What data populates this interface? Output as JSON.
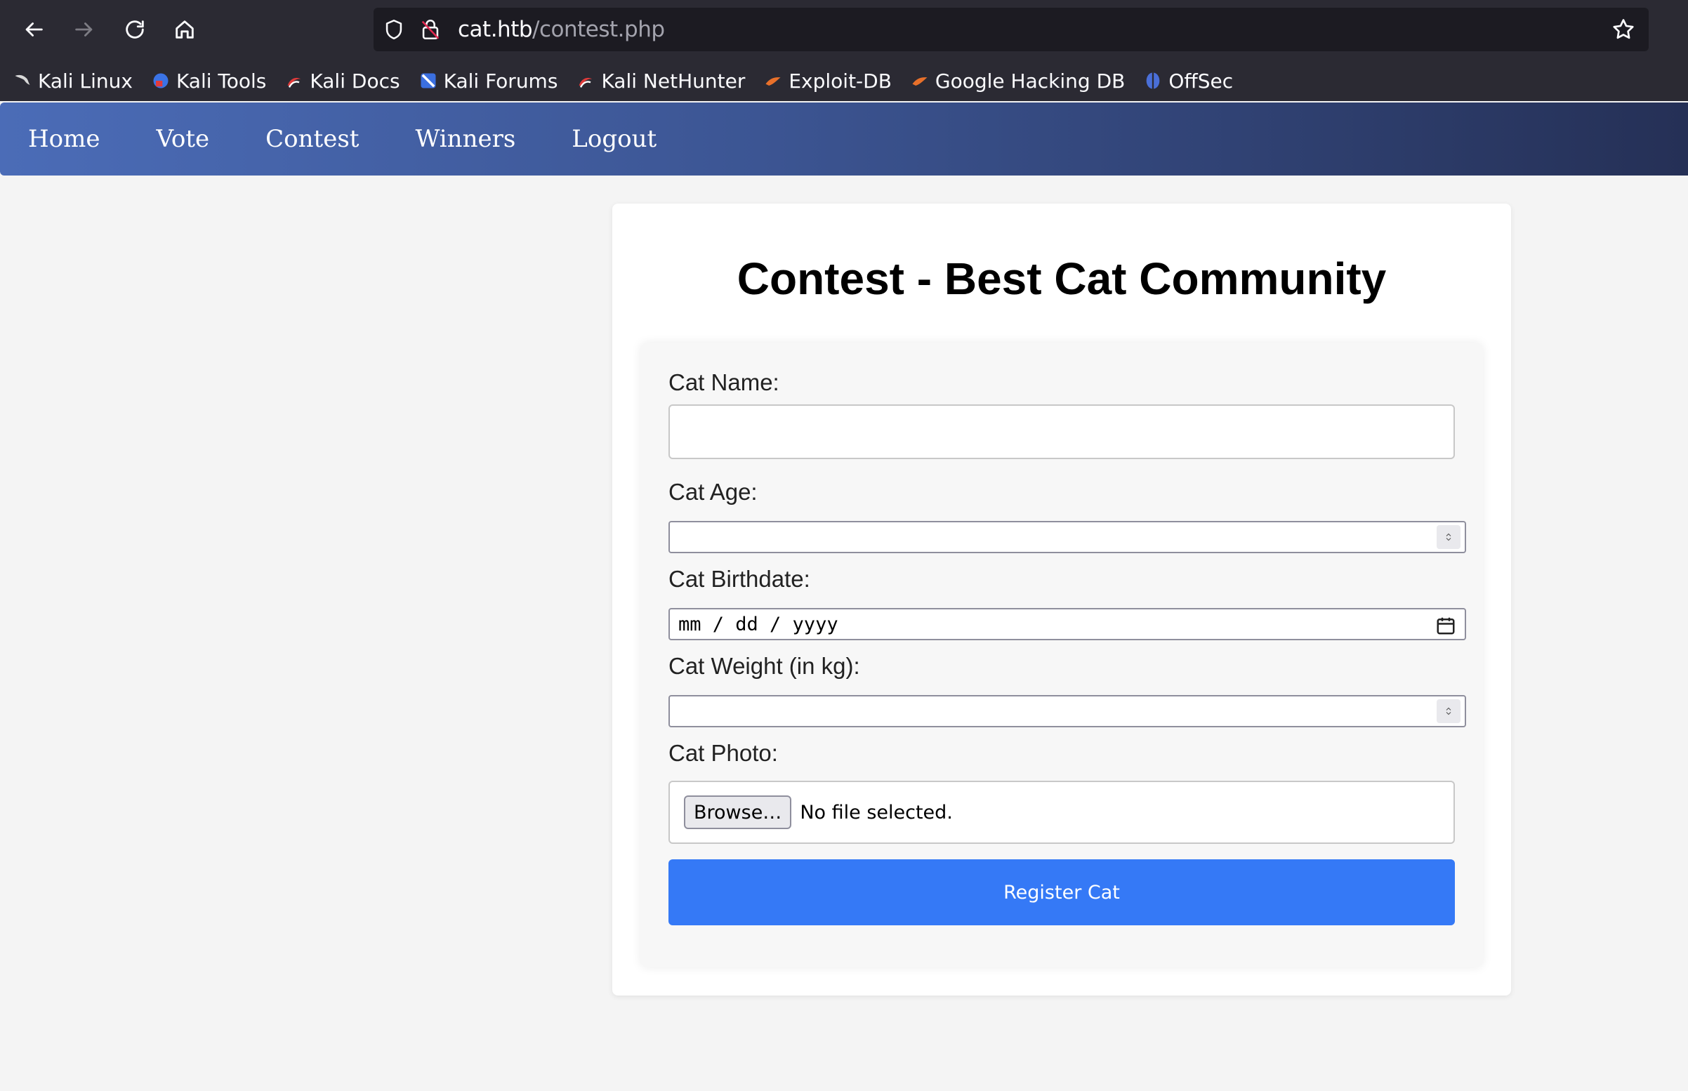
{
  "browser": {
    "url_host": "cat.htb",
    "url_path": "/contest.php",
    "bookmarks": [
      {
        "label": "Kali Linux",
        "icon": "kali-dragon-icon",
        "color": "#d8d8d8"
      },
      {
        "label": "Kali Tools",
        "icon": "kali-tools-icon",
        "color": "#3b73e6"
      },
      {
        "label": "Kali Docs",
        "icon": "kali-docs-icon",
        "color": "#e03b3b"
      },
      {
        "label": "Kali Forums",
        "icon": "kali-forums-icon",
        "color": "#3b6fe0"
      },
      {
        "label": "Kali NetHunter",
        "icon": "kali-nethunter-icon",
        "color": "#e03b3b"
      },
      {
        "label": "Exploit-DB",
        "icon": "exploit-db-icon",
        "color": "#e8702a"
      },
      {
        "label": "Google Hacking DB",
        "icon": "ghdb-icon",
        "color": "#e8702a"
      },
      {
        "label": "OffSec",
        "icon": "offsec-icon",
        "color": "#4a6fd8"
      }
    ]
  },
  "nav": {
    "home": "Home",
    "vote": "Vote",
    "contest": "Contest",
    "winners": "Winners",
    "logout": "Logout"
  },
  "page": {
    "title": "Contest - Best Cat Community"
  },
  "form": {
    "cat_name_label": "Cat Name:",
    "cat_name_value": "",
    "cat_age_label": "Cat Age:",
    "cat_age_value": "",
    "cat_birthdate_label": "Cat Birthdate:",
    "cat_birthdate_placeholder": "mm / dd / yyyy",
    "cat_weight_label": "Cat Weight (in kg):",
    "cat_weight_value": "",
    "cat_photo_label": "Cat Photo:",
    "browse_label": "Browse…",
    "file_status": "No file selected.",
    "submit_label": "Register Cat"
  },
  "colors": {
    "accent": "#3579f6",
    "nav_gradient_start": "#4b6cb7",
    "nav_gradient_end": "#253056"
  }
}
